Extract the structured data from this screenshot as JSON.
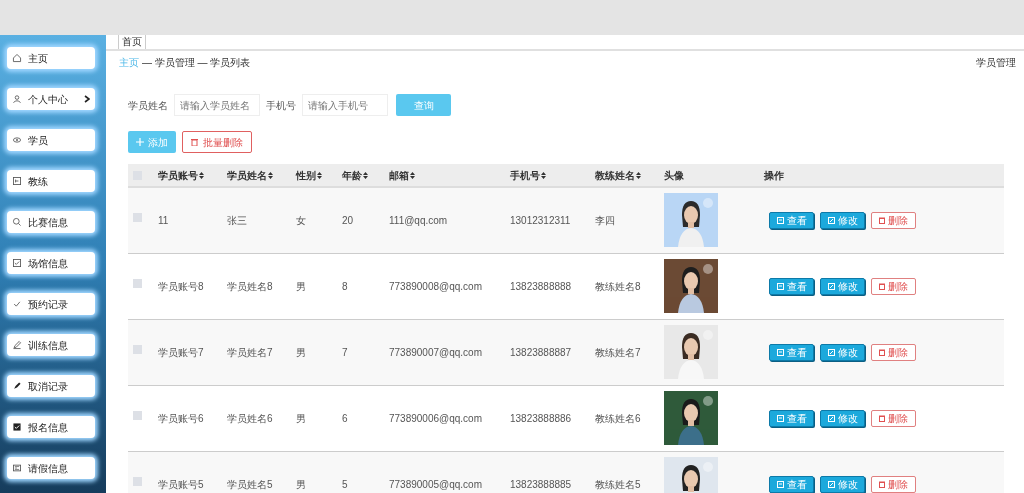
{
  "tabs": [
    {
      "label": "首页",
      "selected": true
    }
  ],
  "breadcrumb": {
    "home": "主页",
    "trail": "— 学员管理 — 学员列表"
  },
  "page_title": "学员管理",
  "sidebar": {
    "items": [
      {
        "label": "主页",
        "has_submenu": false
      },
      {
        "label": "个人中心",
        "has_submenu": true
      },
      {
        "label": "学员",
        "has_submenu": false
      },
      {
        "label": "教练",
        "has_submenu": false
      },
      {
        "label": "比赛信息",
        "has_submenu": false
      },
      {
        "label": "场馆信息",
        "has_submenu": false
      },
      {
        "label": "预约记录",
        "has_submenu": false
      },
      {
        "label": "训练信息",
        "has_submenu": false
      },
      {
        "label": "取消记录",
        "has_submenu": false
      },
      {
        "label": "报名信息",
        "has_submenu": false
      },
      {
        "label": "请假信息",
        "has_submenu": false
      }
    ]
  },
  "search": {
    "fields": [
      {
        "label": "学员姓名",
        "placeholder": "请输入学员姓名"
      },
      {
        "label": "手机号",
        "placeholder": "请输入手机号"
      }
    ],
    "button": "查询"
  },
  "toolbar": [
    {
      "label": "添加",
      "kind": "add"
    },
    {
      "label": "批量删除",
      "kind": "delete"
    }
  ],
  "table": {
    "select_all_checked": false,
    "columns": [
      {
        "label": "学员账号",
        "sortable": true
      },
      {
        "label": "学员姓名",
        "sortable": true
      },
      {
        "label": "性别",
        "sortable": true
      },
      {
        "label": "年龄",
        "sortable": true
      },
      {
        "label": "邮箱",
        "sortable": true
      },
      {
        "label": "手机号",
        "sortable": true
      },
      {
        "label": "教练姓名",
        "sortable": true
      },
      {
        "label": "头像",
        "sortable": false
      },
      {
        "label": "操作",
        "sortable": false
      }
    ],
    "rows": [
      {
        "checked": false,
        "cells": [
          "11",
          "张三",
          "女",
          "20",
          "111@qq.com",
          "13012312311",
          "李四"
        ],
        "actions": [
          {
            "label": "查看",
            "kind": "view"
          },
          {
            "label": "修改",
            "kind": "edit"
          },
          {
            "label": "删除",
            "kind": "delete"
          }
        ]
      },
      {
        "checked": false,
        "cells": [
          "学员账号8",
          "学员姓名8",
          "男",
          "8",
          "773890008@qq.com",
          "13823888888",
          "教练姓名8"
        ],
        "actions": [
          {
            "label": "查看",
            "kind": "view"
          },
          {
            "label": "修改",
            "kind": "edit"
          },
          {
            "label": "删除",
            "kind": "delete"
          }
        ]
      },
      {
        "checked": false,
        "cells": [
          "学员账号7",
          "学员姓名7",
          "男",
          "7",
          "773890007@qq.com",
          "13823888887",
          "教练姓名7"
        ],
        "actions": [
          {
            "label": "查看",
            "kind": "view"
          },
          {
            "label": "修改",
            "kind": "edit"
          },
          {
            "label": "删除",
            "kind": "delete"
          }
        ]
      },
      {
        "checked": false,
        "cells": [
          "学员账号6",
          "学员姓名6",
          "男",
          "6",
          "773890006@qq.com",
          "13823888886",
          "教练姓名6"
        ],
        "actions": [
          {
            "label": "查看",
            "kind": "view"
          },
          {
            "label": "修改",
            "kind": "edit"
          },
          {
            "label": "删除",
            "kind": "delete"
          }
        ]
      },
      {
        "checked": false,
        "cells": [
          "学员账号5",
          "学员姓名5",
          "男",
          "5",
          "773890005@qq.com",
          "13823888885",
          "教练姓名5"
        ],
        "actions": [
          {
            "label": "查看",
            "kind": "view"
          },
          {
            "label": "修改",
            "kind": "edit"
          },
          {
            "label": "删除",
            "kind": "delete"
          }
        ]
      }
    ]
  }
}
